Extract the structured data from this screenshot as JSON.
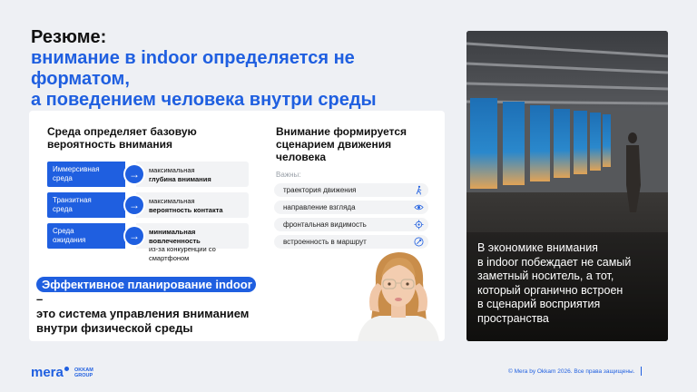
{
  "title": {
    "line1": "Резюме:",
    "line2": "внимание в indoor определяется не форматом,",
    "line3": "а поведением человека внутри среды"
  },
  "left": {
    "heading_line1": "Среда определяет базовую",
    "heading_line2": "вероятность внимания",
    "rows": [
      {
        "env_l1": "Иммерсивная",
        "env_l2": "среда",
        "desc_l1": "максимальная",
        "desc_l2": "глубина внимания"
      },
      {
        "env_l1": "Транзитная",
        "env_l2": "среда",
        "desc_l1": "максимальная",
        "desc_l2": "вероятность контакта"
      },
      {
        "env_l1": "Среда",
        "env_l2": "ожидания",
        "desc_l1": "минимальная вовлеченность",
        "desc_l2": "из-за конкуренции со смартфоном"
      }
    ]
  },
  "right": {
    "heading_line1": "Внимание формируется",
    "heading_line2": "сценарием движения",
    "heading_line3": "человека",
    "important_label": "Важны:",
    "items": [
      {
        "label": "траектория движения",
        "icon": "walking-person-icon"
      },
      {
        "label": "направление взгляда",
        "icon": "eye-icon"
      },
      {
        "label": "фронтальная видимость",
        "icon": "target-icon"
      },
      {
        "label": "встроенность в маршрут",
        "icon": "route-icon"
      }
    ]
  },
  "plan": {
    "highlight": "Эффективное планирование indoor",
    "dash": " –",
    "line2": "это система управления вниманием",
    "line3": "внутри физической среды"
  },
  "photo_text": {
    "line1": "В экономике внимания",
    "line2": "в indoor побеждает не самый",
    "line3": "заметный носитель, а тот,",
    "line4": "который органично встроен",
    "line5": "в сценарий восприятия",
    "line6": "пространства"
  },
  "footer": {
    "logo": "mera",
    "group_l1": "OKKAM",
    "group_l2": "GROUP",
    "copyright": "© Mera by Okkam 2026. Все права защищены."
  },
  "colors": {
    "accent": "#1f5fe0",
    "background": "#eef0f4",
    "card": "#ffffff",
    "pill": "#f2f3f5"
  }
}
